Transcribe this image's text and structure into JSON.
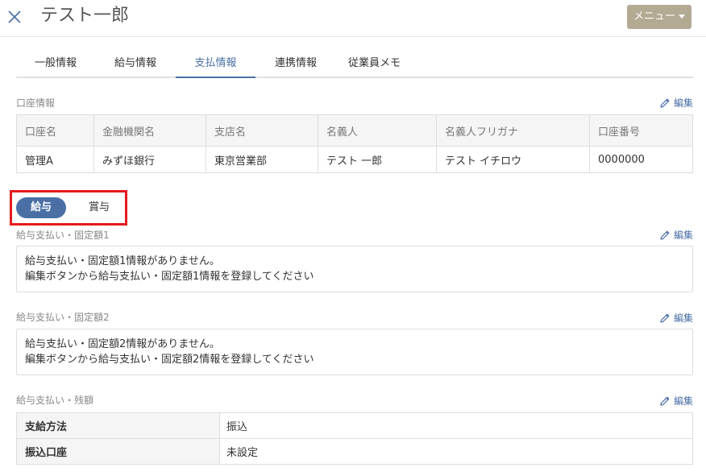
{
  "header": {
    "title": "テスト一郎",
    "menu_label": "メニュー"
  },
  "tabs": [
    {
      "label": "一般情報",
      "active": false
    },
    {
      "label": "給与情報",
      "active": false
    },
    {
      "label": "支払情報",
      "active": true
    },
    {
      "label": "連携情報",
      "active": false
    },
    {
      "label": "従業員メモ",
      "active": false
    }
  ],
  "edit_label": "編集",
  "account": {
    "section_label": "口座情報",
    "columns": [
      "口座名",
      "金融機関名",
      "支店名",
      "名義人",
      "名義人フリガナ",
      "口座番号"
    ],
    "rows": [
      [
        "管理A",
        "みずほ銀行",
        "東京営業部",
        "テスト 一郎",
        "テスト イチロウ",
        "0000000"
      ]
    ]
  },
  "toggle": {
    "options": [
      "給与",
      "賞与"
    ],
    "selected": "給与"
  },
  "fixed1": {
    "section_label": "給与支払い・固定額1",
    "line1": "給与支払い・固定額1情報がありません。",
    "line2": "編集ボタンから給与支払い・固定額1情報を登録してください"
  },
  "fixed2": {
    "section_label": "給与支払い・固定額2",
    "line1": "給与支払い・固定額2情報がありません。",
    "line2": "編集ボタンから給与支払い・固定額2情報を登録してください"
  },
  "remainder": {
    "section_label": "給与支払い・残額",
    "rows": [
      {
        "label": "支給方法",
        "value": "振込"
      },
      {
        "label": "振込口座",
        "value": "未設定"
      }
    ]
  },
  "colors": {
    "accent": "#4a6fa5",
    "menu_button": "#b3aa94",
    "highlight_frame": "#e41a1c"
  }
}
